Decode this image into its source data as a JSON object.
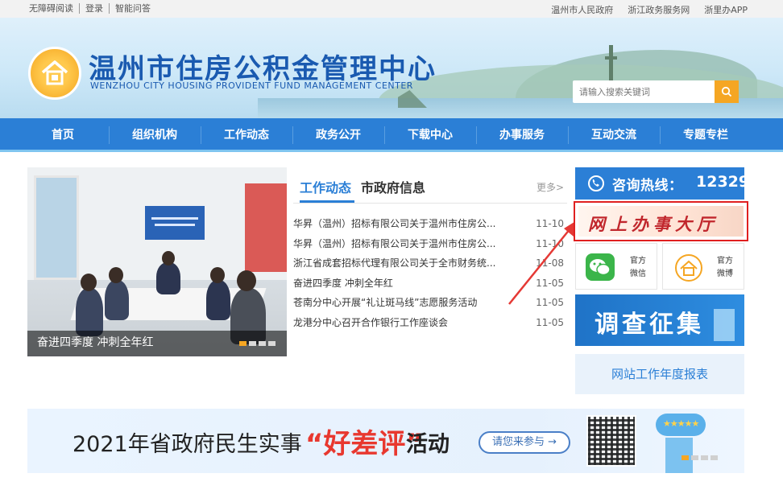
{
  "topbar": {
    "left_links": [
      "无障碍阅读",
      "登录",
      "智能问答"
    ],
    "right_links": [
      "温州市人民政府",
      "浙江政务服务网",
      "浙里办APP"
    ]
  },
  "header": {
    "title": "温州市住房公积金管理中心",
    "subtitle": "WENZHOU CITY HOUSING PROVIDENT FUND MANAGEMENT CENTER",
    "search_placeholder": "请输入搜索关键词"
  },
  "nav": [
    "首页",
    "组织机构",
    "工作动态",
    "政务公开",
    "下载中心",
    "办事服务",
    "互动交流",
    "专题专栏"
  ],
  "slideshow": {
    "caption": "奋进四季度 冲刺全年红",
    "slide_count": 4,
    "active_index": 0
  },
  "news": {
    "tabs": [
      "工作动态",
      "市政府信息"
    ],
    "active_tab": 0,
    "more": "更多>",
    "items": [
      {
        "title": "华昇（温州）招标有限公司关于温州市住房公...",
        "date": "11-10"
      },
      {
        "title": "华昇（温州）招标有限公司关于温州市住房公...",
        "date": "11-10"
      },
      {
        "title": "浙江省成套招标代理有限公司关于全市财务统...",
        "date": "11-08"
      },
      {
        "title": "奋进四季度 冲刺全年红",
        "date": "11-05"
      },
      {
        "title": "苍南分中心开展“礼让斑马线”志愿服务活动",
        "date": "11-05"
      },
      {
        "title": "龙港分中心召开合作银行工作座谈会",
        "date": "11-05"
      }
    ]
  },
  "sidebar": {
    "hotline_label": "咨询热线：",
    "hotline_number": "12329",
    "online_hall": "网上办事大厅",
    "wechat": {
      "line1": "官方",
      "line2": "微信"
    },
    "weibo": {
      "line1": "官方",
      "line2": "微博"
    },
    "survey": "调查征集",
    "report": "网站工作年度报表"
  },
  "promo": {
    "text_before": "2021年省政府民生实事",
    "highlight": "“好差评”",
    "text_after": "活动",
    "button": "请您来参与 →",
    "rating_stars": "★★★★★",
    "dot_count": 4,
    "active_dot": 0
  },
  "colors": {
    "primary_blue": "#2b7fd6",
    "accent_orange": "#f5a623",
    "alert_red": "#e02020"
  }
}
